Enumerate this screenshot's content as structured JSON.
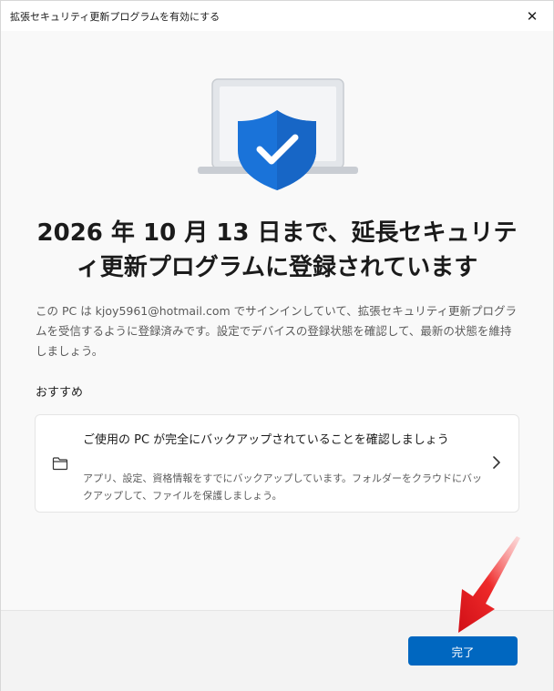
{
  "window": {
    "title": "拡張セキュリティ更新プログラムを有効にする",
    "close_glyph": "✕"
  },
  "main": {
    "headline_line1": "2026 年 10 月 13 日まで、延長セキュリテ",
    "headline_line2": "ィ更新プログラムに登録されています",
    "body": "この PC は kjoy5961@hotmail.com でサインインしていて、拡張セキュリティ更新プログラムを受信するように登録済みです。設定でデバイスの登録状態を確認して、最新の状態を維持しましょう。",
    "recommend_label": "おすすめ"
  },
  "card": {
    "title": "ご使用の PC が完全にバックアップされていることを確認しましょう",
    "description": "アプリ、設定、資格情報をすでにバックアップしています。フォルダーをクラウドにバックアップして、ファイルを保護しましょう。",
    "icon": "folder-icon"
  },
  "footer": {
    "done_label": "完了"
  },
  "colors": {
    "accent": "#0067c0",
    "shield": "#1a73d9",
    "annotation_arrow": "#e8141c"
  }
}
